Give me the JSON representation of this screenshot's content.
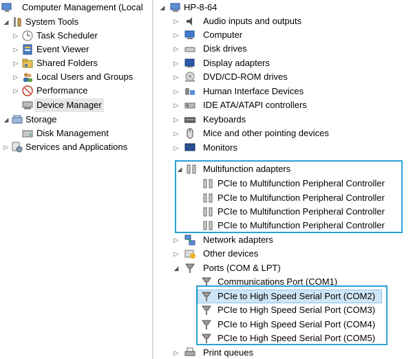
{
  "left_tree": {
    "root": "Computer Management (Local",
    "system_tools": "System Tools",
    "task_scheduler": "Task Scheduler",
    "event_viewer": "Event Viewer",
    "shared_folders": "Shared Folders",
    "local_users": "Local Users and Groups",
    "performance": "Performance",
    "device_manager": "Device Manager",
    "storage": "Storage",
    "disk_management": "Disk Management",
    "services": "Services and Applications"
  },
  "right_tree": {
    "computer_name": "HP-8-64",
    "audio": "Audio inputs and outputs",
    "computer": "Computer",
    "disk_drives": "Disk drives",
    "display": "Display adapters",
    "dvd": "DVD/CD-ROM drives",
    "hid": "Human Interface Devices",
    "ide": "IDE ATA/ATAPI controllers",
    "keyboards": "Keyboards",
    "mice": "Mice and other pointing devices",
    "monitors": "Monitors",
    "multifunction": "Multifunction adapters",
    "multifunction_children": [
      "PCIe to Multifunction Peripheral Controller",
      "PCIe to Multifunction Peripheral Controller",
      "PCIe to Multifunction Peripheral Controller",
      "PCIe to Multifunction Peripheral Controller"
    ],
    "network": "Network adapters",
    "other": "Other devices",
    "ports": "Ports (COM & LPT)",
    "ports_children": [
      "Communications Port (COM1)",
      "PCIe to High Speed Serial Port (COM2)",
      "PCIe to High Speed Serial Port (COM3)",
      "PCIe to High Speed Serial Port (COM4)",
      "PCIe to High Speed Serial Port (COM5)"
    ],
    "print_queues": "Print queues"
  },
  "colors": {
    "highlight_box": "#2aa0d8",
    "selection": "#cfe6f7"
  }
}
